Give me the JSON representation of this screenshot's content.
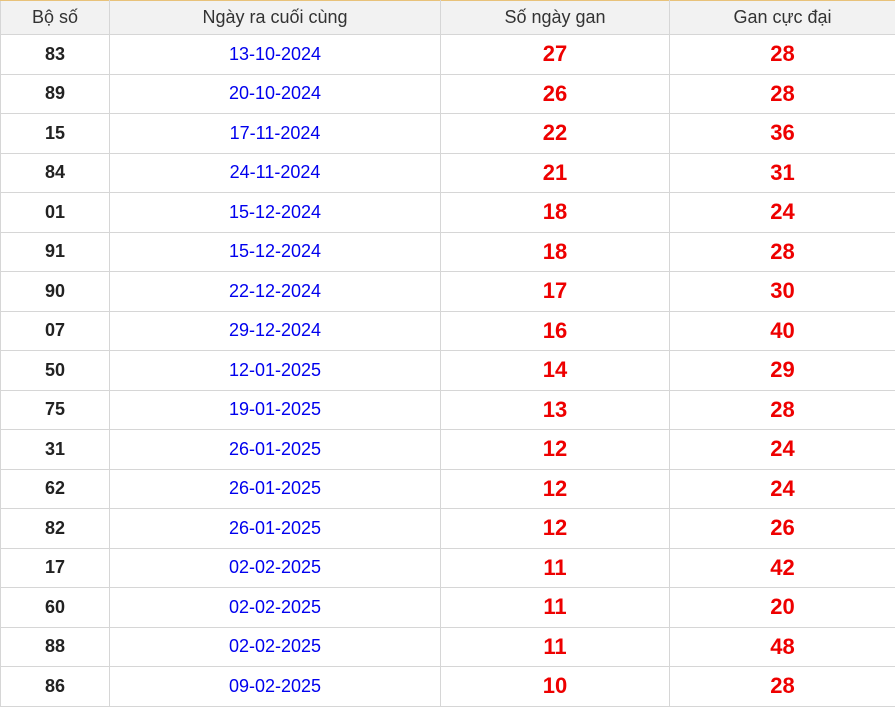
{
  "headers": [
    "Bộ số",
    "Ngày ra cuối cùng",
    "Số ngày gan",
    "Gan cực đại"
  ],
  "colors": {
    "date": "#0000ee",
    "numbers": "#ee0000",
    "header_bg": "#f2f2f2"
  },
  "rows": [
    {
      "cap": "83",
      "date": "13-10-2024",
      "gan": "27",
      "max": "28"
    },
    {
      "cap": "89",
      "date": "20-10-2024",
      "gan": "26",
      "max": "28"
    },
    {
      "cap": "15",
      "date": "17-11-2024",
      "gan": "22",
      "max": "36"
    },
    {
      "cap": "84",
      "date": "24-11-2024",
      "gan": "21",
      "max": "31"
    },
    {
      "cap": "01",
      "date": "15-12-2024",
      "gan": "18",
      "max": "24"
    },
    {
      "cap": "91",
      "date": "15-12-2024",
      "gan": "18",
      "max": "28"
    },
    {
      "cap": "90",
      "date": "22-12-2024",
      "gan": "17",
      "max": "30"
    },
    {
      "cap": "07",
      "date": "29-12-2024",
      "gan": "16",
      "max": "40"
    },
    {
      "cap": "50",
      "date": "12-01-2025",
      "gan": "14",
      "max": "29"
    },
    {
      "cap": "75",
      "date": "19-01-2025",
      "gan": "13",
      "max": "28"
    },
    {
      "cap": "31",
      "date": "26-01-2025",
      "gan": "12",
      "max": "24"
    },
    {
      "cap": "62",
      "date": "26-01-2025",
      "gan": "12",
      "max": "24"
    },
    {
      "cap": "82",
      "date": "26-01-2025",
      "gan": "12",
      "max": "26"
    },
    {
      "cap": "17",
      "date": "02-02-2025",
      "gan": "11",
      "max": "42"
    },
    {
      "cap": "60",
      "date": "02-02-2025",
      "gan": "11",
      "max": "20"
    },
    {
      "cap": "88",
      "date": "02-02-2025",
      "gan": "11",
      "max": "48"
    },
    {
      "cap": "86",
      "date": "09-02-2025",
      "gan": "10",
      "max": "28"
    }
  ]
}
